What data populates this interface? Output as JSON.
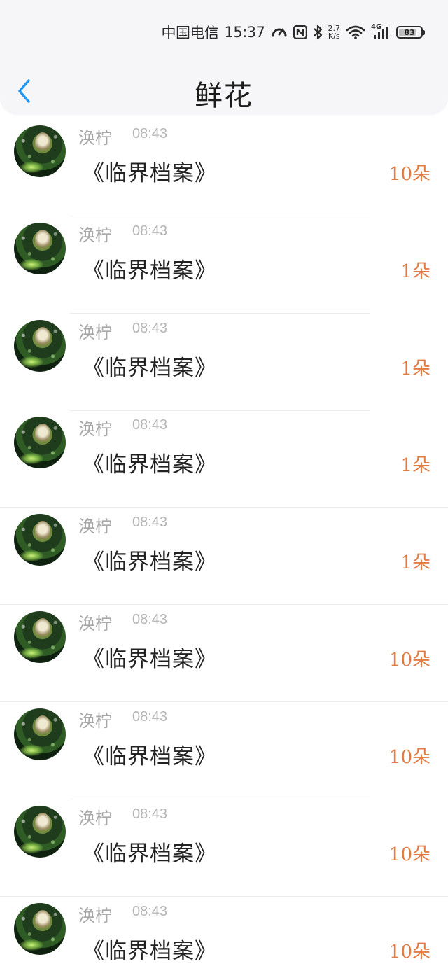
{
  "status_bar": {
    "carrier": "中国电信",
    "time": "15:37",
    "net_speed_value": "2.7",
    "net_speed_unit": "K/s",
    "network_type": "4G",
    "battery": "83",
    "battery_fraction": 0.83,
    "icons": [
      "speedometer-icon",
      "nfc-icon",
      "bluetooth-icon",
      "wifi-icon",
      "signal-icon",
      "battery-icon"
    ]
  },
  "header": {
    "back_icon": "chevron-left-icon",
    "title": "鲜花",
    "accent_color": "#2196f3"
  },
  "rows": [
    {
      "name": "涣柠",
      "time": "08:43",
      "book": "《临界档案》",
      "count": "10朵"
    },
    {
      "name": "涣柠",
      "time": "08:43",
      "book": "《临界档案》",
      "count": "1朵"
    },
    {
      "name": "涣柠",
      "time": "08:43",
      "book": "《临界档案》",
      "count": "1朵"
    },
    {
      "name": "涣柠",
      "time": "08:43",
      "book": "《临界档案》",
      "count": "1朵"
    },
    {
      "name": "涣柠",
      "time": "08:43",
      "book": "《临界档案》",
      "count": "1朵"
    },
    {
      "name": "涣柠",
      "time": "08:43",
      "book": "《临界档案》",
      "count": "10朵"
    },
    {
      "name": "涣柠",
      "time": "08:43",
      "book": "《临界档案》",
      "count": "10朵"
    },
    {
      "name": "涣柠",
      "time": "08:43",
      "book": "《临界档案》",
      "count": "10朵"
    },
    {
      "name": "涣柠",
      "time": "08:43",
      "book": "《临界档案》",
      "count": "10朵"
    }
  ],
  "colors": {
    "count": "#e07b43",
    "name": "#a7a7a7",
    "time": "#b5b5b5",
    "book": "#222222"
  }
}
